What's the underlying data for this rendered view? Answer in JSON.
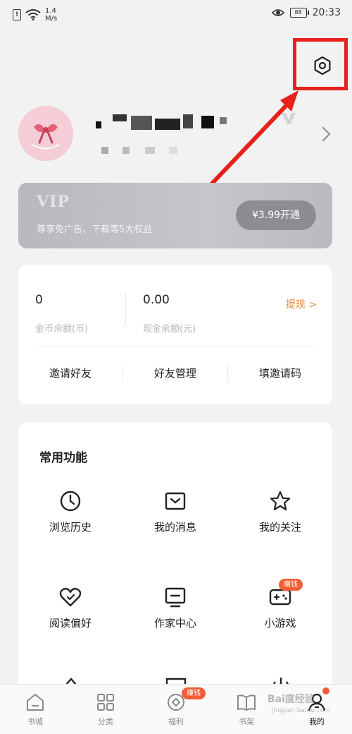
{
  "status_bar": {
    "sim_label": "!",
    "speed_value": "1.4",
    "speed_unit": "M/s",
    "battery": "88",
    "time": "20:33"
  },
  "vip": {
    "title": "VIP",
    "description": "尊享免广告、下载等5大权益",
    "button_label": "¥3.99开通"
  },
  "balance": {
    "coin_value": "0",
    "coin_label": "金币余额(币)",
    "cash_value": "0.00",
    "cash_label": "现金余额(元)",
    "withdraw_label": "提现 >"
  },
  "friends": {
    "invite": "邀请好友",
    "manage": "好友管理",
    "code": "填邀请码"
  },
  "functions": {
    "title": "常用功能",
    "items": [
      {
        "label": "浏览历史",
        "icon": "clock-icon"
      },
      {
        "label": "我的消息",
        "icon": "message-icon"
      },
      {
        "label": "我的关注",
        "icon": "star-icon"
      },
      {
        "label": "阅读偏好",
        "icon": "heart-icon"
      },
      {
        "label": "作家中心",
        "icon": "writer-icon"
      },
      {
        "label": "小游戏",
        "icon": "game-icon"
      }
    ],
    "earn_badge": "赚钱"
  },
  "nav": {
    "items": [
      {
        "label": "书城",
        "icon": "home-icon"
      },
      {
        "label": "分类",
        "icon": "grid-icon"
      },
      {
        "label": "福利",
        "icon": "coin-icon",
        "badge": "赚钱"
      },
      {
        "label": "书架",
        "icon": "book-icon"
      },
      {
        "label": "我的",
        "icon": "user-icon"
      }
    ]
  },
  "watermark": {
    "brand": "Bai度经验",
    "url": "jingyan.baidu.com"
  },
  "colors": {
    "accent_orange": "#e7893a",
    "badge_red": "#f25d36",
    "annotation_red": "#e8211c"
  }
}
